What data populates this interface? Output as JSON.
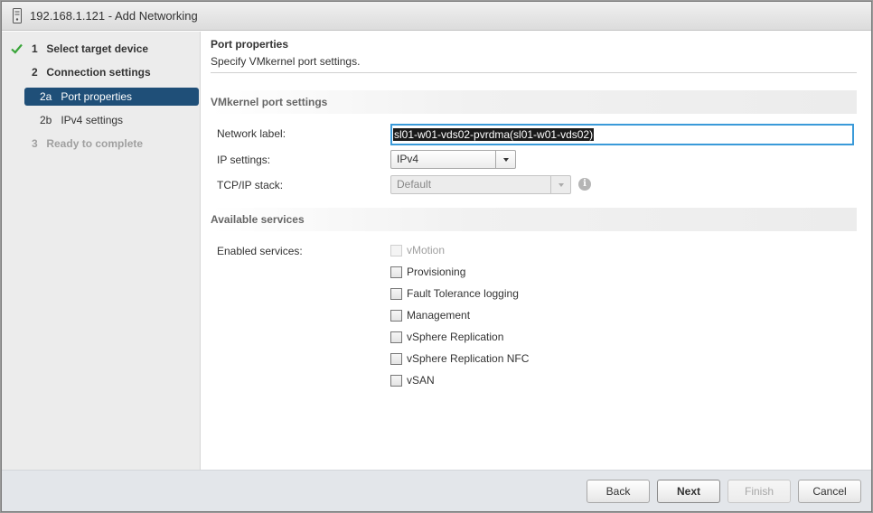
{
  "window": {
    "title": "192.168.1.121 - Add Networking"
  },
  "sidebar": {
    "steps": [
      {
        "num": "1",
        "label": "Select target device",
        "state": "completed"
      },
      {
        "num": "2",
        "label": "Connection settings",
        "state": "current-parent"
      },
      {
        "num": "2a",
        "label": "Port properties",
        "state": "active"
      },
      {
        "num": "2b",
        "label": "IPv4 settings",
        "state": "pending"
      },
      {
        "num": "3",
        "label": "Ready to complete",
        "state": "disabled"
      }
    ]
  },
  "main": {
    "title": "Port properties",
    "subtitle": "Specify VMkernel port settings.",
    "vmkernel_section": "VMkernel port settings",
    "network_label": {
      "label": "Network label:",
      "value": "sl01-w01-vds02-pvrdma(sl01-w01-vds02)"
    },
    "ip_settings": {
      "label": "IP settings:",
      "value": "IPv4"
    },
    "tcpip_stack": {
      "label": "TCP/IP stack:",
      "value": "Default",
      "disabled": true
    },
    "services_section": "Available services",
    "enabled_services_label": "Enabled services:",
    "services": [
      {
        "label": "vMotion",
        "checked": false,
        "disabled": true
      },
      {
        "label": "Provisioning",
        "checked": false,
        "disabled": false
      },
      {
        "label": "Fault Tolerance logging",
        "checked": false,
        "disabled": false
      },
      {
        "label": "Management",
        "checked": false,
        "disabled": false
      },
      {
        "label": "vSphere Replication",
        "checked": false,
        "disabled": false
      },
      {
        "label": "vSphere Replication NFC",
        "checked": false,
        "disabled": false
      },
      {
        "label": "vSAN",
        "checked": false,
        "disabled": false
      }
    ]
  },
  "footer": {
    "back": "Back",
    "next": "Next",
    "finish": "Finish",
    "cancel": "Cancel"
  },
  "colors": {
    "active_step_bg": "#1f4f78",
    "check_green": "#3aa53a",
    "input_focus_border": "#3a9ad9"
  },
  "icons": {
    "title": "server-host-icon",
    "completed_step": "checkmark-icon",
    "tcpip_info": "info-icon"
  }
}
